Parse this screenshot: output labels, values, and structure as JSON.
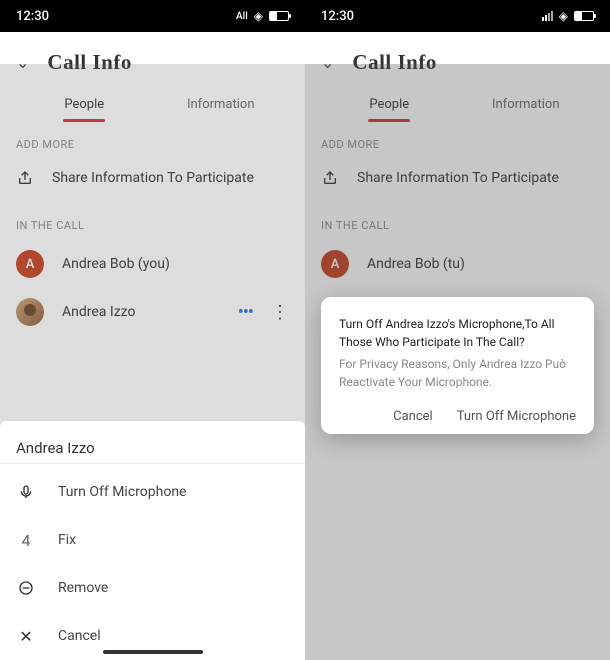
{
  "status_bar": {
    "time": "12:30",
    "network_label": "All"
  },
  "header": {
    "title": "Call Info"
  },
  "tabs": {
    "people": "People",
    "information": "Information"
  },
  "sections": {
    "add_more": "ADD MORE",
    "in_the_call": "IN THE CALL"
  },
  "share_label": "Share Information To Participate",
  "participants": {
    "you_left": "Andrea Bob (you)",
    "you_right": "Andrea Bob (tu)",
    "other": "Andrea Izzo",
    "avatar_initial": "A"
  },
  "sheet": {
    "title": "Andrea Izzo",
    "items": {
      "mic": "Turn Off Microphone",
      "fix": "Fix",
      "fix_num": "4",
      "remove": "Remove",
      "cancel": "Cancel"
    }
  },
  "dialog": {
    "line1": "Turn Off Andrea Izzo's Microphone,To All Those Who Participate In The Call?",
    "line2": "For Privacy Reasons, Only Andrea Izzo Può Reactivate Your Microphone.",
    "cancel": "Cancel",
    "confirm": "Turn Off Microphone"
  }
}
